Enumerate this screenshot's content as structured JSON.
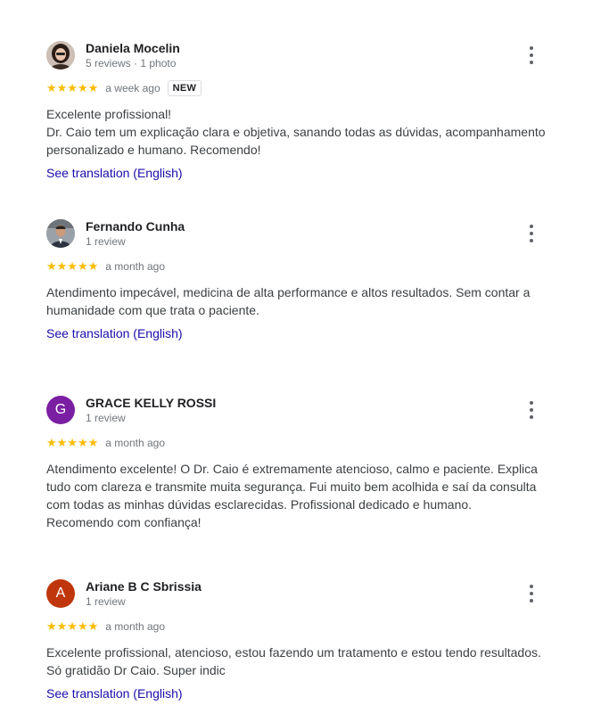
{
  "reviews": [
    {
      "author": "Daniela Mocelin",
      "meta": "5 reviews · 1 photo",
      "avatar_icon": "profile-photo-woman",
      "stars": "★★★★★",
      "rating": 5,
      "date": "a week ago",
      "badge": "NEW",
      "text": "Excelente profissional!\nDr. Caio tem um explicação clara e objetiva, sanando todas as dúvidas, acompanhamento\npersonalizado e humano. Recomendo!",
      "translate": "See translation (English)"
    },
    {
      "author": "Fernando Cunha",
      "meta": "1 review",
      "avatar_icon": "profile-photo-man",
      "stars": "★★★★★",
      "rating": 5,
      "date": "a month ago",
      "text": "Atendimento impecável, medicina de alta performance e altos resultados. Sem contar a\nhumanidade com que trata o paciente.",
      "translate": "See translation (English)"
    },
    {
      "author": "GRACE KELLY ROSSI",
      "meta": "1 review",
      "avatar_letter": "G",
      "avatar_color": "#7b1fa2",
      "stars": "★★★★★",
      "rating": 5,
      "date": "a month ago",
      "text": "Atendimento excelente! O Dr. Caio é extremamente atencioso, calmo e paciente. Explica\ntudo com clareza e transmite muita segurança. Fui muito bem acolhida e saí da consulta\ncom todas as minhas dúvidas esclarecidas. Profissional dedicado e humano.\nRecomendo com confiança!"
    },
    {
      "author": "Ariane B C Sbrissia",
      "meta": "1 review",
      "avatar_letter": "A",
      "avatar_color": "#c0360c",
      "stars": "★★★★★",
      "rating": 5,
      "date": "a month ago",
      "text": "Excelente profissional, atencioso, estou fazendo um tratamento e estou tendo resultados.\nSó gratidão Dr Caio. Super indic",
      "translate": "See translation (English)"
    }
  ],
  "colors": {
    "star": "#fbbc04",
    "link": "#1a0dab",
    "muted": "#70757a"
  }
}
